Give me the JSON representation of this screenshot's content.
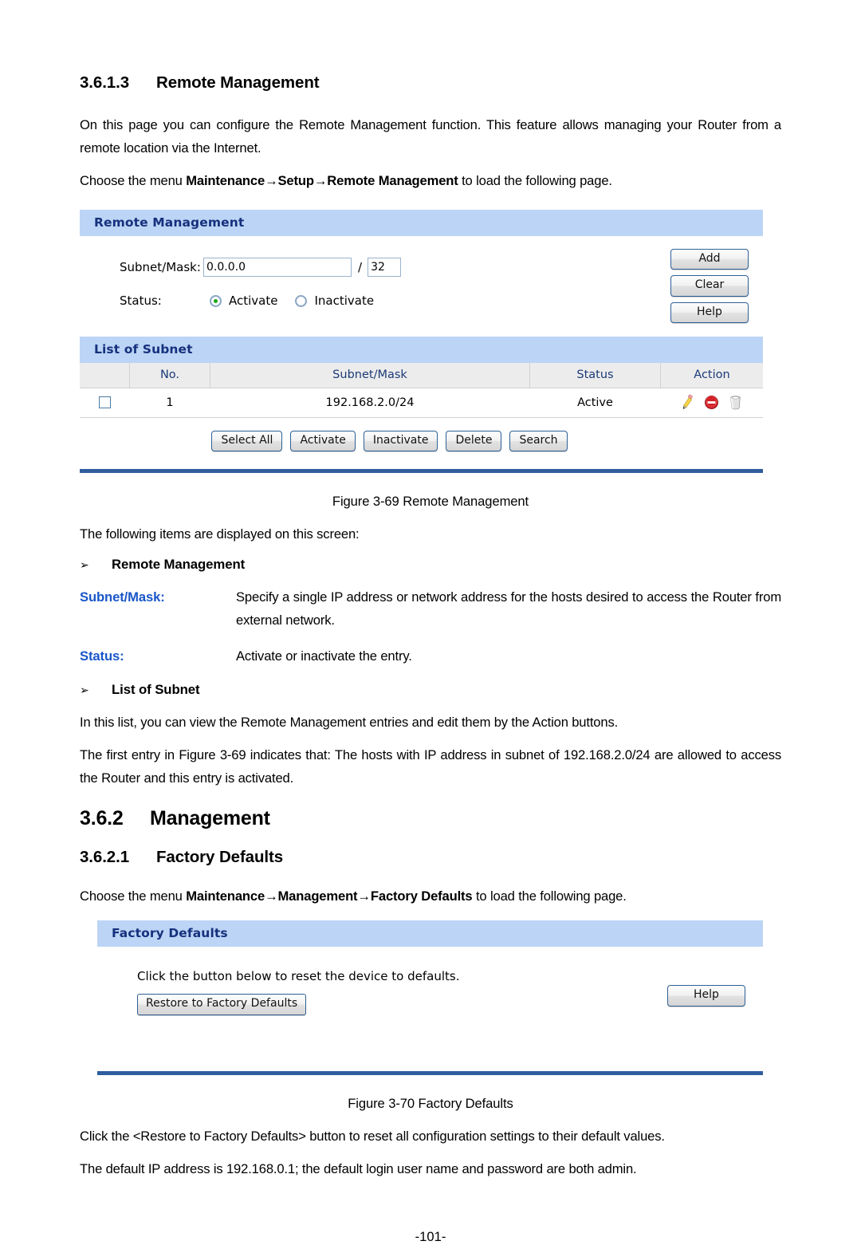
{
  "section_remote": {
    "number": "3.6.1.3",
    "title": "Remote Management",
    "intro": "On this page you can configure the Remote Management function. This feature allows managing your Router from a remote location via the Internet.",
    "choose_prefix": "Choose the menu ",
    "choose_path": "Maintenance→Setup→Remote Management",
    "choose_suffix": " to load the following page.",
    "caption": "Figure 3-69 Remote Management",
    "items_intro": "The following items are displayed on this screen:"
  },
  "remote_panel": {
    "title": "Remote Management",
    "subnet_label": "Subnet/Mask:",
    "subnet_value": "0.0.0.0",
    "mask_value": "32",
    "slash": "/",
    "status_label": "Status:",
    "radio_activate": "Activate",
    "radio_inactivate": "Inactivate",
    "selected_status": "Activate",
    "buttons": [
      "Add",
      "Clear",
      "Help"
    ]
  },
  "list_panel": {
    "title": "List of Subnet",
    "headers": [
      "",
      "No.",
      "Subnet/Mask",
      "Status",
      "Action"
    ],
    "rows": [
      {
        "checked": false,
        "no": "1",
        "subnet_mask": "192.168.2.0/24",
        "status": "Active",
        "actions": [
          "edit-pencil-icon",
          "disable-icon",
          "delete-trash-icon"
        ]
      }
    ],
    "buttons": [
      "Select All",
      "Activate",
      "Inactivate",
      "Delete",
      "Search"
    ]
  },
  "definitions": {
    "bullet_glyph": "➢",
    "group1_title": "Remote Management",
    "rows": [
      {
        "term": "Subnet/Mask:",
        "desc": "Specify a single IP address or network address for the hosts desired to access the Router from external network."
      },
      {
        "term": "Status:",
        "desc": "Activate or inactivate the entry."
      }
    ],
    "group2_title": "List of Subnet",
    "group2_text": "In this list, you can view the Remote Management entries and edit them by the Action buttons.",
    "group2_note": "The first entry in Figure 3-69 indicates that: The hosts with IP address in subnet of 192.168.2.0/24 are allowed to access the Router and this entry is activated."
  },
  "section_management": {
    "number": "3.6.2",
    "title": "Management"
  },
  "section_factory": {
    "number": "3.6.2.1",
    "title": "Factory Defaults",
    "choose_prefix": "Choose the menu ",
    "choose_path": "Maintenance→Management→Factory Defaults",
    "choose_suffix": " to load the following page.",
    "caption": "Figure 3-70 Factory Defaults",
    "note1": "Click the <Restore to Factory Defaults> button to reset all configuration settings to their default values.",
    "note2": "The default IP address is 192.168.0.1; the default login user name and password are both admin."
  },
  "factory_panel": {
    "title": "Factory Defaults",
    "instruction": "Click the button below to reset the device to defaults.",
    "restore_button": "Restore to Factory Defaults",
    "help_button": "Help"
  },
  "footer": {
    "page_number": "-101-"
  },
  "colors": {
    "panel_header_bg": "#bcd4f5",
    "panel_header_text": "#16317d",
    "panel_footer_bar": "#2f5d9e",
    "table_header_bg": "#ececec",
    "table_header_text": "#1a3a77",
    "term_blue": "#1956c8",
    "radio_green": "#16a516",
    "disable_red": "#d42027"
  }
}
